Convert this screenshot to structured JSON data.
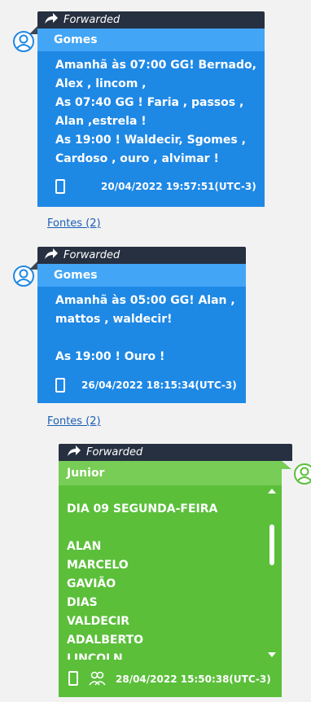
{
  "messages": [
    {
      "forwarded_label": "Forwarded",
      "sender": "Gomes",
      "text": "Amanhã às 07:00 GG! Bernado,\nAlex , lincom ,\nAs 07:40 GG ! Faria , passos ,\nAlan ,estrela !\nAs 19:00 ! Waldecir, Sgomes ,\nCardoso , ouro , alvimar !",
      "timestamp": "20/04/2022 19:57:51(UTC-3)",
      "sources_link": "Fontes (2)"
    },
    {
      "forwarded_label": "Forwarded",
      "sender": "Gomes",
      "text": "Amanhã às 05:00 GG! Alan ,\nmattos , waldecir!\n\nAs 19:00 ! Ouro !",
      "timestamp": "26/04/2022 18:15:34(UTC-3)",
      "sources_link": "Fontes (2)"
    },
    {
      "forwarded_label": "Forwarded",
      "sender": "Junior",
      "text": "DIA 09 SEGUNDA-FEIRA\n\nALAN\nMARCELO\nGAVIÃO\nDIAS\nVALDECIR\nADALBERTO\nLINCOLN",
      "timestamp": "28/04/2022 15:50:38(UTC-3)"
    }
  ],
  "colors": {
    "incoming_bubble": "#1e88e5",
    "incoming_sender_bar": "#42a5f5",
    "outgoing_bubble": "#5bbf3a",
    "outgoing_sender_bar": "#77cd55",
    "forwarded_bar": "#263040"
  },
  "icons": {
    "forward": "forward-arrow-icon",
    "avatar": "user-avatar-icon",
    "device": "mobile-phone-icon",
    "group": "group-users-icon"
  }
}
